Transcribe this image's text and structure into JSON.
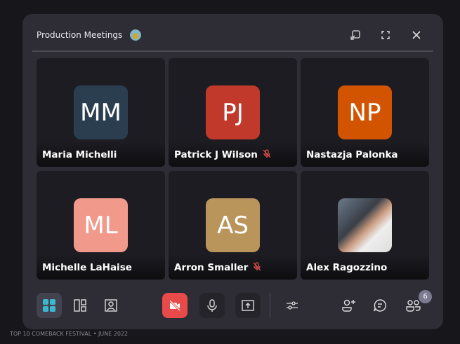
{
  "window": {
    "title": "Production Meetings"
  },
  "participants": [
    {
      "initials": "MM",
      "name": "Maria Michelli",
      "color": "#2b3e50",
      "muted": false
    },
    {
      "initials": "PJ",
      "name": "Patrick J Wilson",
      "color": "#c0392b",
      "muted": true
    },
    {
      "initials": "NP",
      "name": "Nastazja Palonka",
      "color": "#d35400",
      "muted": false
    },
    {
      "initials": "ML",
      "name": "Michelle LaHaise",
      "color": "#f1998b",
      "muted": false
    },
    {
      "initials": "AS",
      "name": "Arron Smaller",
      "color": "#b9955c",
      "muted": true
    },
    {
      "initials": "",
      "name": "Alex Ragozzino",
      "color": "",
      "muted": false
    }
  ],
  "toolbar": {
    "participant_count": "6",
    "accent": "#3bb8d0",
    "camera_off_color": "#e84a4a"
  },
  "footer": "TOP 10 COMEBACK FESTIVAL • JUNE 2022"
}
